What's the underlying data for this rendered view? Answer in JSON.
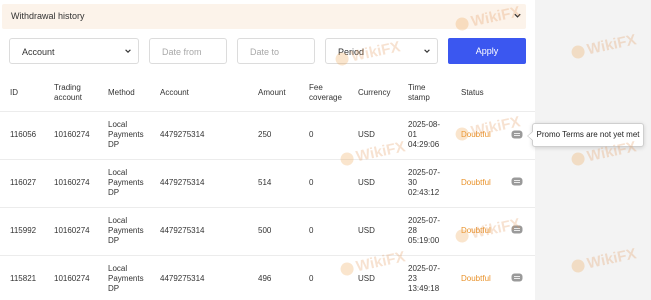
{
  "header": {
    "title": "Withdrawal history"
  },
  "filters": {
    "account_select": "Account",
    "date_from_placeholder": "Date from",
    "date_to_placeholder": "Date to",
    "period_select": "Period",
    "apply_label": "Apply"
  },
  "columns": {
    "id": "ID",
    "trading_account_1": "Trading",
    "trading_account_2": "account",
    "method": "Method",
    "account": "Account",
    "amount": "Amount",
    "fee_1": "Fee",
    "fee_2": "coverage",
    "currency": "Currency",
    "time_1": "Time",
    "time_2": "stamp",
    "status": "Status"
  },
  "rows": [
    {
      "id": "116056",
      "trading_account": "10160274",
      "method_1": "Local",
      "method_2": "Payments",
      "method_3": "DP",
      "account": "4479275314",
      "amount": "250",
      "fee": "0",
      "currency": "USD",
      "date_1": "2025-08-",
      "date_2": "01",
      "time": "04:29:06",
      "status": "Doubtful"
    },
    {
      "id": "116027",
      "trading_account": "10160274",
      "method_1": "Local",
      "method_2": "Payments",
      "method_3": "DP",
      "account": "4479275314",
      "amount": "514",
      "fee": "0",
      "currency": "USD",
      "date_1": "2025-07-",
      "date_2": "30",
      "time": "02:43:12",
      "status": "Doubtful"
    },
    {
      "id": "115992",
      "trading_account": "10160274",
      "method_1": "Local",
      "method_2": "Payments",
      "method_3": "DP",
      "account": "4479275314",
      "amount": "500",
      "fee": "0",
      "currency": "USD",
      "date_1": "2025-07-",
      "date_2": "28",
      "time": "05:19:00",
      "status": "Doubtful"
    },
    {
      "id": "115821",
      "trading_account": "10160274",
      "method_1": "Local",
      "method_2": "Payments",
      "method_3": "DP",
      "account": "4479275314",
      "amount": "496",
      "fee": "0",
      "currency": "USD",
      "date_1": "2025-07-",
      "date_2": "23",
      "time": "13:49:18",
      "status": "Doubtful"
    }
  ],
  "tooltip": {
    "text": "Promo Terms are not yet met"
  },
  "watermark": {
    "text": "WikiFX"
  },
  "colors": {
    "accent": "#3b57f0",
    "status_doubtful": "#e9922a",
    "header_bg": "#fcf3ea"
  },
  "icons": {
    "chat": "chat-bubble-icon",
    "chevron": "chevron-down-icon"
  }
}
